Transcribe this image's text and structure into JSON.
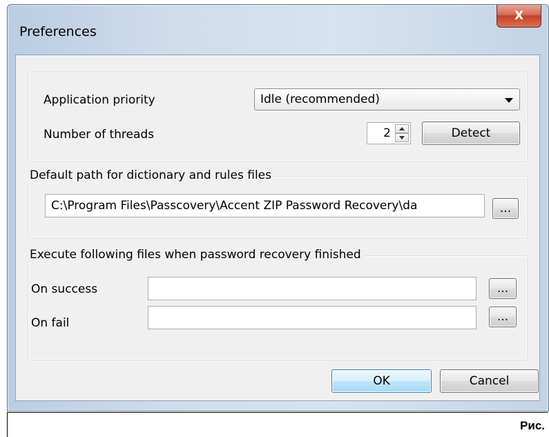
{
  "window": {
    "title": "Preferences",
    "close_label": "X"
  },
  "priority": {
    "label": "Application priority",
    "selected": "Idle (recommended)"
  },
  "threads": {
    "label": "Number of threads",
    "value": "2",
    "detect_label": "Detect"
  },
  "dictionary": {
    "legend": "Default path for dictionary and rules files",
    "path": "C:\\Program Files\\Passcovery\\Accent ZIP Password Recovery\\da",
    "browse_label": "..."
  },
  "execute": {
    "legend": "Execute following files when password recovery finished",
    "on_success_label": "On success",
    "on_success_value": "",
    "on_fail_label": "On fail",
    "on_fail_value": "",
    "browse_label": "..."
  },
  "buttons": {
    "ok": "OK",
    "cancel": "Cancel"
  },
  "caption": "Рис."
}
